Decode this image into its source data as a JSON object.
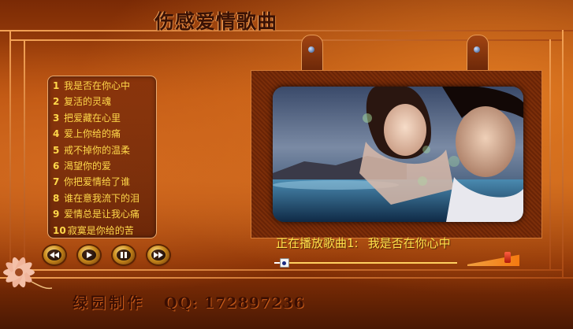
{
  "title": "伤感爱情歌曲",
  "playlist": [
    {
      "num": "1",
      "title": "我是否在你心中"
    },
    {
      "num": "2",
      "title": "复活的灵魂"
    },
    {
      "num": "3",
      "title": "把爱藏在心里"
    },
    {
      "num": "4",
      "title": "爱上你给的痛"
    },
    {
      "num": "5",
      "title": "戒不掉你的温柔"
    },
    {
      "num": "6",
      "title": "渴望你的爱"
    },
    {
      "num": "7",
      "title": "你把爱情给了谁"
    },
    {
      "num": "8",
      "title": "谁在意我流下的泪"
    },
    {
      "num": "9",
      "title": "爱情总是让我心痛"
    },
    {
      "num": "10",
      "title": "寂寞是你给的苦"
    }
  ],
  "controls": {
    "icons": [
      "rewind-icon",
      "play-icon",
      "pause-icon",
      "fast-forward-icon"
    ]
  },
  "now_playing": {
    "label": "正在播放歌曲1:",
    "song": "我是否在你心中"
  },
  "progress": {
    "fraction": 0.03
  },
  "volume": {
    "fraction": 0.78
  },
  "footer": {
    "author": "绿园制作",
    "qq": "QQ: 172897236"
  },
  "colors": {
    "accent_text": "#ffe04a",
    "background": "#c4601a",
    "footer_text": "#3a0e02"
  }
}
